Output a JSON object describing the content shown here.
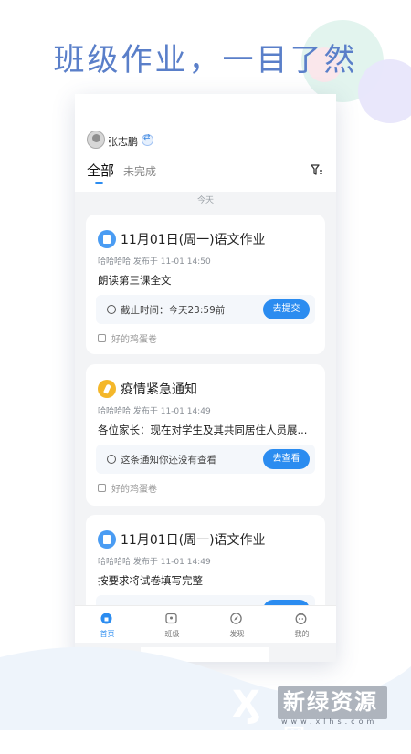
{
  "headline": "班级作业，一目了然",
  "user": {
    "name": "张志鹏"
  },
  "tabs": [
    {
      "label": "全部",
      "active": true
    },
    {
      "label": "未完成",
      "active": false
    }
  ],
  "date_label": "今天",
  "cards": [
    {
      "icon": "document-icon",
      "title": "11月01日(周一)语文作业",
      "meta": "哈哈哈哈 发布于 11-01 14:50",
      "body": "朗读第三课全文",
      "action_text": "截止时间：今天23:59前",
      "button": "去提交",
      "footer": "好的鸡蛋卷"
    },
    {
      "icon": "megaphone-icon",
      "title": "疫情紧急通知",
      "meta": "哈哈哈哈 发布于 11-01 14:49",
      "body": "各位家长：现在对学生及其共同居住人员展...",
      "action_text": "这条通知你还没有查看",
      "button": "去查看",
      "footer": "好的鸡蛋卷"
    },
    {
      "icon": "document-icon",
      "title": "11月01日(周一)语文作业",
      "meta": "哈哈哈哈 发布于 11-01 14:49",
      "body": "按要求将试卷填写完整"
    }
  ],
  "bottom_nav": [
    {
      "label": "首页",
      "active": true
    },
    {
      "label": "班级",
      "active": false
    },
    {
      "label": "发现",
      "active": false
    },
    {
      "label": "我的",
      "active": false
    }
  ],
  "watermark": {
    "name": "新绿资源网",
    "url": "www.xlhs.com"
  },
  "colors": {
    "accent": "#2b8cf0",
    "headline": "#5a7fc9",
    "notice": "#f4b72a"
  }
}
